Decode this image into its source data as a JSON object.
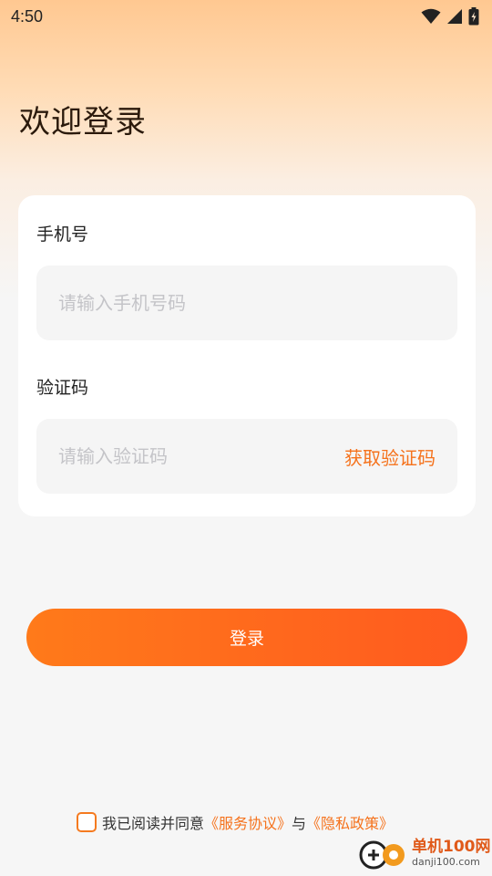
{
  "status_bar": {
    "time": "4:50"
  },
  "page": {
    "title": "欢迎登录"
  },
  "form": {
    "phone_label": "手机号",
    "phone_placeholder": "请输入手机号码",
    "code_label": "验证码",
    "code_placeholder": "请输入验证码",
    "get_code_label": "获取验证码"
  },
  "login_button_label": "登录",
  "agreement": {
    "prefix": "我已阅读并同意",
    "service_link": "《服务协议》",
    "joiner": "与",
    "privacy_link": "《隐私政策》"
  },
  "watermark": {
    "name": "单机100网",
    "url": "danji100.com"
  },
  "colors": {
    "accent": "#f5721c",
    "button_start": "#ff7a1a",
    "button_end": "#ff5a1f"
  },
  "icons": [
    "wifi-icon",
    "cell-signal-icon",
    "battery-charging-icon",
    "checkbox-icon",
    "watermark-logo-icon"
  ]
}
